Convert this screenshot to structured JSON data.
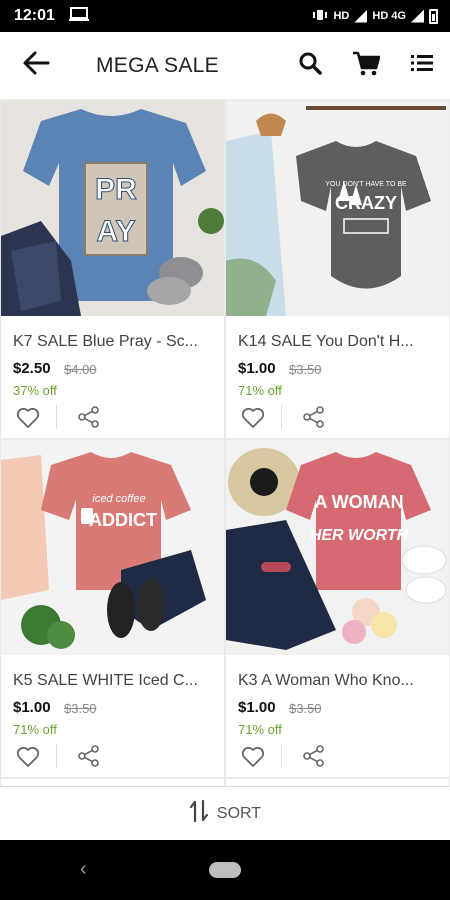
{
  "status_bar": {
    "time": "12:01",
    "network_label": "HD",
    "network_label_2": "HD 4G"
  },
  "app_bar": {
    "title": "MEGA SALE"
  },
  "products": [
    {
      "name": "K7 SALE Blue Pray - Sc...",
      "price": "$2.50",
      "original_price": "$4.00",
      "discount": "37% off"
    },
    {
      "name": "K14 SALE You Don't H...",
      "price": "$1.00",
      "original_price": "$3.50",
      "discount": "71% off"
    },
    {
      "name": "K5 SALE WHITE Iced C...",
      "price": "$1.00",
      "original_price": "$3.50",
      "discount": "71% off"
    },
    {
      "name": "K3 A Woman Who Kno...",
      "price": "$1.00",
      "original_price": "$3.50",
      "discount": "71% off"
    }
  ],
  "product_images": [
    {
      "shirt_color": "#5b84b4",
      "print_text": [
        "PR",
        "AY"
      ]
    },
    {
      "shirt_color": "#5e5e60",
      "print_text": [
        "YOU DON'T HAVE TO BE",
        "CRAZY"
      ]
    },
    {
      "shirt_color": "#d97a76",
      "print_text": [
        "iced coffee",
        "ADDICT"
      ]
    },
    {
      "shirt_color": "#d56a72",
      "print_text": [
        "A WOMAN",
        "HER WORTH"
      ]
    }
  ],
  "sort_bar": {
    "label": "SORT"
  },
  "colors": {
    "discount_green": "#6aa32e",
    "background": "#e9e9e9"
  }
}
